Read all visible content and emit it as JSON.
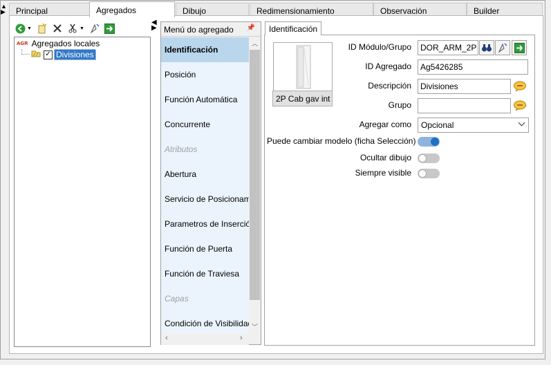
{
  "tabs": [
    {
      "label": "Principal"
    },
    {
      "label": "Agregados"
    },
    {
      "label": "Dibujo"
    },
    {
      "label": "Redimensionamiento"
    },
    {
      "label": "Observación"
    },
    {
      "label": "Builder"
    }
  ],
  "active_tab": "Agregados",
  "tree": {
    "root_label": "Agregados locales",
    "child_label": "Divisiones",
    "child_checked": true
  },
  "menu": {
    "title": "Menú do agregado",
    "items": [
      {
        "label": "Identificación"
      },
      {
        "label": "Posición"
      },
      {
        "label": "Función Automática"
      },
      {
        "label": "Concurrente"
      },
      {
        "label": "Atributos"
      },
      {
        "label": "Abertura"
      },
      {
        "label": "Servicio de Posicionamiento"
      },
      {
        "label": "Parametros de Inserción"
      },
      {
        "label": "Función de Puerta"
      },
      {
        "label": "Función de Traviesa"
      },
      {
        "label": "Capas"
      },
      {
        "label": "Condición de Visibilidad"
      }
    ]
  },
  "detail": {
    "tab_label": "Identificación",
    "thumbnail_button": "2P Cab gav int",
    "fields": {
      "id_modulo_label": "ID Módulo/Grupo",
      "id_modulo_value": "DOR_ARM_2P",
      "id_agregado_label": "ID Agregado",
      "id_agregado_value": "Ag5426285",
      "descripcion_label": "Descripción",
      "descripcion_value": "Divisiones",
      "grupo_label": "Grupo",
      "grupo_value": "",
      "agregar_como_label": "Agregar como",
      "agregar_como_value": "Opcional",
      "puede_cambiar_label": "Puede cambiar modelo (ficha Selección)",
      "puede_cambiar_on": true,
      "ocultar_dibujo_label": "Ocultar dibujo",
      "ocultar_dibujo_on": false,
      "siempre_visible_label": "Siempre visible",
      "siempre_visible_on": false
    }
  },
  "colors": {
    "selection": "#3178c6",
    "menu_selected": "#b9d6ec",
    "toggle_on": "#1f6fc2"
  }
}
